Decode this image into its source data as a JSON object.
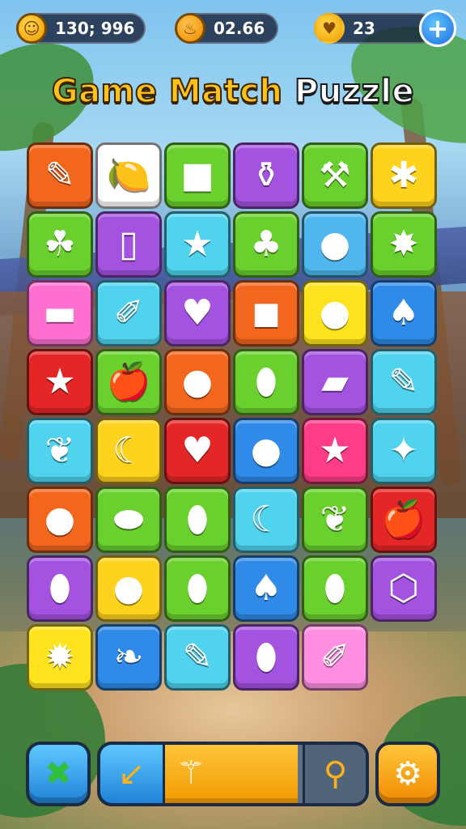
{
  "hud": {
    "score": {
      "value": "130; 996",
      "icon": "coin-icon"
    },
    "timer": {
      "value": "02.66",
      "icon": "balloon-coin-icon"
    },
    "hearts": {
      "value": "23",
      "icon": "heart-icon"
    },
    "add_button": {
      "label": "+",
      "icon": "plus-icon"
    }
  },
  "title": {
    "part1": "Game Match ",
    "part2": "Puzzle"
  },
  "board": {
    "columns": 6,
    "tiles": [
      {
        "name": "feather",
        "glyph": "✎",
        "bg": "#f2661e"
      },
      {
        "name": "lemon",
        "glyph": "🍋",
        "bg": "#ffffff"
      },
      {
        "name": "square-block",
        "glyph": "■",
        "bg": "#6ad02e"
      },
      {
        "name": "jar",
        "glyph": "⚱",
        "bg": "#a452e0"
      },
      {
        "name": "hammer",
        "glyph": "⚒",
        "bg": "#6ad02e"
      },
      {
        "name": "gift-box",
        "glyph": "✱",
        "bg": "#ffd21e"
      },
      {
        "name": "broccoli",
        "glyph": "☘",
        "bg": "#6ad02e"
      },
      {
        "name": "phone",
        "glyph": "▯",
        "bg": "#a452e0"
      },
      {
        "name": "star",
        "glyph": "★",
        "bg": "#4fd3ee"
      },
      {
        "name": "pepper",
        "glyph": "♣",
        "bg": "#6ad02e"
      },
      {
        "name": "orange-balloon",
        "glyph": "●",
        "bg": "#4fb7ee"
      },
      {
        "name": "starburst",
        "glyph": "✸",
        "bg": "#6ad02e"
      },
      {
        "name": "eraser",
        "glyph": "▬",
        "bg": "#ff6fd0"
      },
      {
        "name": "purple-pen",
        "glyph": "✐",
        "bg": "#4fd3ee"
      },
      {
        "name": "pink-heart",
        "glyph": "♥",
        "bg": "#a452e0"
      },
      {
        "name": "cube",
        "glyph": "◼",
        "bg": "#f2661e"
      },
      {
        "name": "green-balloon",
        "glyph": "●",
        "bg": "#ffe31e"
      },
      {
        "name": "purple-leaf",
        "glyph": "♠",
        "bg": "#2f8ae8"
      },
      {
        "name": "blue-star",
        "glyph": "★",
        "bg": "#e52626"
      },
      {
        "name": "apple",
        "glyph": "🍎",
        "bg": "#6ad02e"
      },
      {
        "name": "blue-apple",
        "glyph": "●",
        "bg": "#f2661e"
      },
      {
        "name": "lime",
        "glyph": "⬮",
        "bg": "#6ad02e"
      },
      {
        "name": "gadget",
        "glyph": "▰",
        "bg": "#a452e0"
      },
      {
        "name": "rolling-pin",
        "glyph": "✎",
        "bg": "#4fd3ee"
      },
      {
        "name": "leaf",
        "glyph": "❦",
        "bg": "#4fd3ee"
      },
      {
        "name": "banana",
        "glyph": "☾",
        "bg": "#ffd21e"
      },
      {
        "name": "green-heart",
        "glyph": "♥",
        "bg": "#e52626"
      },
      {
        "name": "plum",
        "glyph": "●",
        "bg": "#2f8ae8"
      },
      {
        "name": "pink-star",
        "glyph": "★",
        "bg": "#ff3d86"
      },
      {
        "name": "green-cross-star",
        "glyph": "✦",
        "bg": "#4fd3ee"
      },
      {
        "name": "blue-apple-2",
        "glyph": "●",
        "bg": "#f2661e"
      },
      {
        "name": "cucumber",
        "glyph": "⬬",
        "bg": "#6ad02e"
      },
      {
        "name": "mango",
        "glyph": "⬮",
        "bg": "#6ad02e"
      },
      {
        "name": "banana-2",
        "glyph": "☾",
        "bg": "#4fd3ee"
      },
      {
        "name": "leaf-2",
        "glyph": "❦",
        "bg": "#6ad02e"
      },
      {
        "name": "red-apple",
        "glyph": "🍎",
        "bg": "#e52626"
      },
      {
        "name": "pear",
        "glyph": "⬮",
        "bg": "#a452e0"
      },
      {
        "name": "blueberry",
        "glyph": "●",
        "bg": "#ffd21e"
      },
      {
        "name": "mango-2",
        "glyph": "⬮",
        "bg": "#6ad02e"
      },
      {
        "name": "eggplant",
        "glyph": "♠",
        "bg": "#2f8ae8"
      },
      {
        "name": "green-pear",
        "glyph": "⬮",
        "bg": "#6ad02e"
      },
      {
        "name": "blue-cube",
        "glyph": "⬡",
        "bg": "#a452e0"
      },
      {
        "name": "red-flower",
        "glyph": "✹",
        "bg": "#ffe31e"
      },
      {
        "name": "purple-feather",
        "glyph": "❧",
        "bg": "#2f8ae8"
      },
      {
        "name": "crayon",
        "glyph": "✎",
        "bg": "#4fd3ee"
      },
      {
        "name": "red-egg",
        "glyph": "⬮",
        "bg": "#a452e0"
      },
      {
        "name": "pink-pencil",
        "glyph": "✐",
        "bg": "#ff8fe0"
      }
    ]
  },
  "toolbar": {
    "shuffle": {
      "icon": "shuffle-x-icon",
      "glyph": "✖"
    },
    "undo": {
      "icon": "arrow-down-left-icon",
      "glyph": "↙"
    },
    "wand": {
      "icon": "magic-wand-icon",
      "glyph": "⚲"
    },
    "hint_progress": 0.66,
    "search": {
      "icon": "magnifier-icon",
      "glyph": "⚲"
    },
    "settings": {
      "icon": "gear-icon",
      "glyph": "⚙"
    }
  }
}
